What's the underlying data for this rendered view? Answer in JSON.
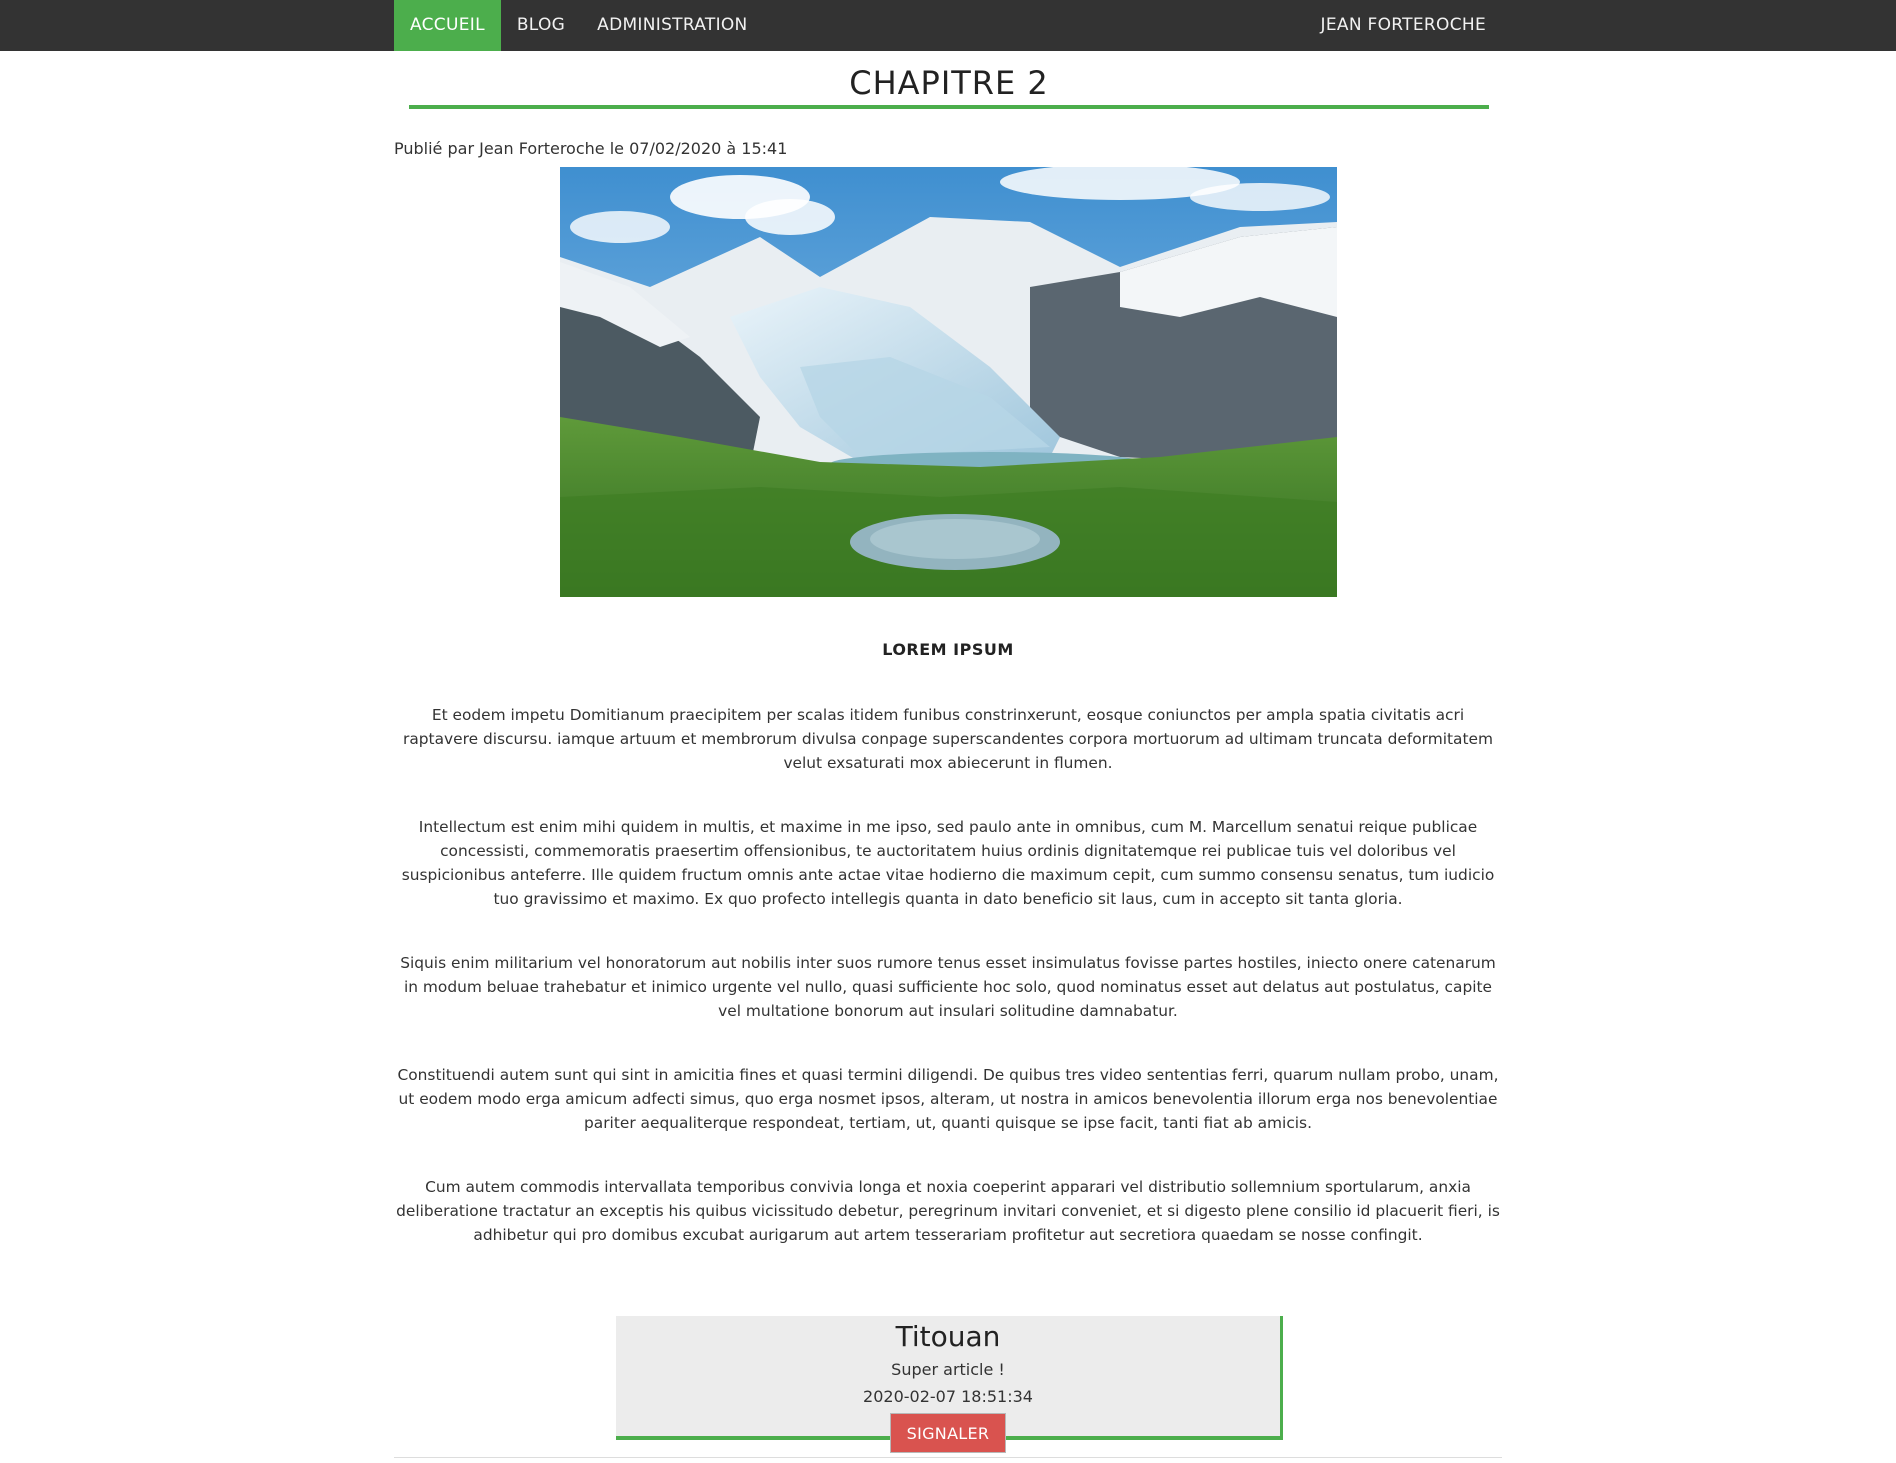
{
  "nav": {
    "items": [
      {
        "label": "ACCUEIL",
        "active": true
      },
      {
        "label": "BLOG",
        "active": false
      },
      {
        "label": "ADMINISTRATION",
        "active": false
      }
    ],
    "user": "JEAN FORTEROCHE"
  },
  "article": {
    "title": "CHAPITRE 2",
    "meta": "Publié par Jean Forteroche le 07/02/2020 à 15:41",
    "subheading": "LOREM IPSUM",
    "paragraphs": [
      "Et eodem impetu Domitianum praecipitem per scalas itidem funibus constrinxerunt, eosque coniunctos per ampla spatia civitatis acri raptavere discursu. iamque artuum et membrorum divulsa conpage superscandentes corpora mortuorum ad ultimam truncata deformitatem velut exsaturati mox abiecerunt in flumen.",
      "Intellectum est enim mihi quidem in multis, et maxime in me ipso, sed paulo ante in omnibus, cum M. Marcellum senatui reique publicae concessisti, commemoratis praesertim offensionibus, te auctoritatem huius ordinis dignitatemque rei publicae tuis vel doloribus vel suspicionibus anteferre. Ille quidem fructum omnis ante actae vitae hodierno die maximum cepit, cum summo consensu senatus, tum iudicio tuo gravissimo et maximo. Ex quo profecto intellegis quanta in dato beneficio sit laus, cum in accepto sit tanta gloria.",
      "Siquis enim militarium vel honoratorum aut nobilis inter suos rumore tenus esset insimulatus fovisse partes hostiles, iniecto onere catenarum in modum beluae trahebatur et inimico urgente vel nullo, quasi sufficiente hoc solo, quod nominatus esset aut delatus aut postulatus, capite vel multatione bonorum aut insulari solitudine damnabatur.",
      "Constituendi autem sunt qui sint in amicitia fines et quasi termini diligendi. De quibus tres video sententias ferri, quarum nullam probo, unam, ut eodem modo erga amicum adfecti simus, quo erga nosmet ipsos, alteram, ut nostra in amicos benevolentia illorum erga nos benevolentiae pariter aequaliterque respondeat, tertiam, ut, quanti quisque se ipse facit, tanti fiat ab amicis.",
      "Cum autem commodis intervallata temporibus convivia longa et noxia coeperint apparari vel distributio sollemnium sportularum, anxia deliberatione tractatur an exceptis his quibus vicissitudo debetur, peregrinum invitari conveniet, et si digesto plene consilio id placuerit fieri, is adhibetur qui pro domibus excubat aurigarum aut artem tesserariam profitetur aut secretiora quaedam se nosse confingit."
    ]
  },
  "comment": {
    "author": "Titouan",
    "text": "Super article !",
    "date": "2020-02-07 18:51:34",
    "report_label": "SIGNALER"
  },
  "colors": {
    "accent": "#4cae4c",
    "navbar": "#333333",
    "danger": "#d9534f"
  }
}
